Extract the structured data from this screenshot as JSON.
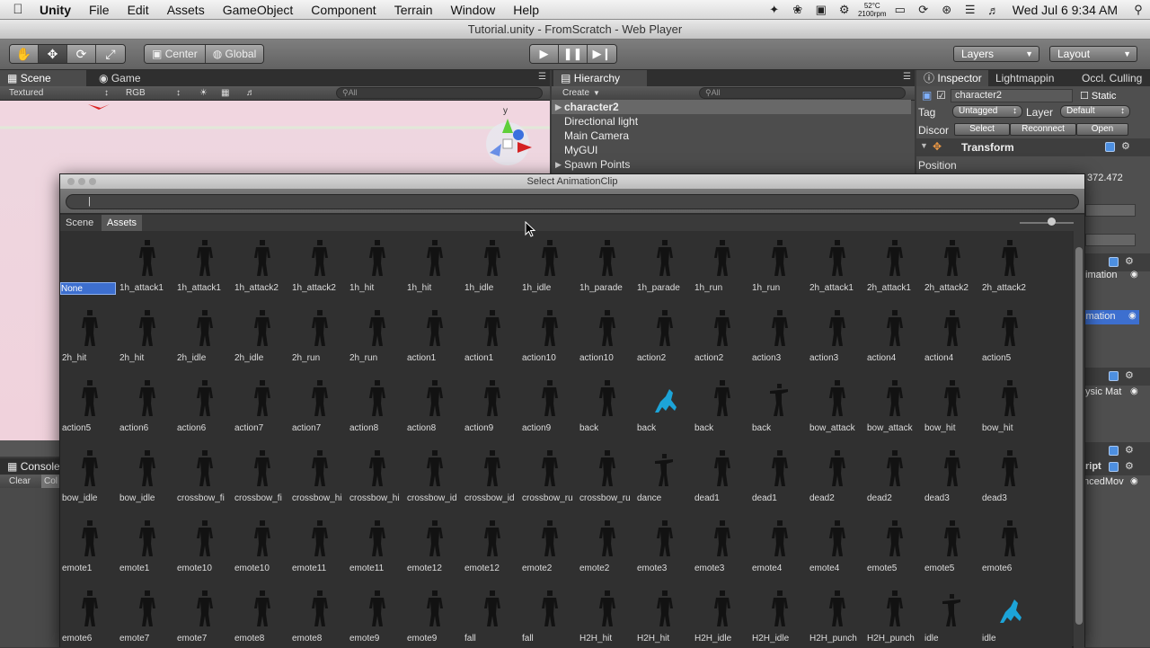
{
  "menubar": {
    "app_name": "Unity",
    "items": [
      "File",
      "Edit",
      "Assets",
      "GameObject",
      "Component",
      "Terrain",
      "Window",
      "Help"
    ],
    "temperature": "52°C",
    "rpm": "2100rpm",
    "clock": "Wed Jul 6  9:34 AM"
  },
  "window": {
    "title": "Tutorial.unity - FromScratch - Web Player"
  },
  "toolbar": {
    "pivot": "Center",
    "space": "Global",
    "layers": "Layers",
    "layout": "Layout"
  },
  "scene_panel": {
    "tabs": [
      "Scene",
      "Game"
    ],
    "render_mode": "Textured",
    "color_mode": "RGB",
    "search_placeholder": "All",
    "gizmo_axis": "y"
  },
  "hierarchy": {
    "tab": "Hierarchy",
    "create": "Create",
    "search_placeholder": "All",
    "items": [
      {
        "label": "character2",
        "selected": true,
        "expandable": true
      },
      {
        "label": "Directional light",
        "selected": false,
        "expandable": false
      },
      {
        "label": "Main Camera",
        "selected": false,
        "expandable": false
      },
      {
        "label": "MyGUI",
        "selected": false,
        "expandable": false
      },
      {
        "label": "Spawn Points",
        "selected": false,
        "expandable": true
      }
    ]
  },
  "inspector": {
    "tabs": [
      "Inspector",
      "Lightmappin",
      "Occl. Culling"
    ],
    "object_name": "character2",
    "static_label": "Static",
    "tag_label": "Tag",
    "tag_value": "Untagged",
    "layer_label": "Layer",
    "layer_value": "Default",
    "prefab_label": "Discor",
    "prefab_buttons": [
      "Select",
      "Reconnect",
      "Open"
    ],
    "transform_title": "Transform",
    "position_label": "Position",
    "position_value_partial": "372.472",
    "animation_partial": "imation",
    "animation_selected_partial": "imation",
    "physic_partial": "ysic Mat",
    "script_partial": "ript",
    "script_name_partial": "ncedMov"
  },
  "console": {
    "tab": "Console",
    "clear": "Clear",
    "col": "Col"
  },
  "dialog": {
    "title": "Select AnimationClip",
    "search_value": "",
    "tabs": [
      "Scene",
      "Assets"
    ],
    "active_tab": "Assets",
    "items": [
      {
        "label": "None",
        "type": "none"
      },
      {
        "label": "1h_attack1",
        "type": "dark"
      },
      {
        "label": "1h_attack1",
        "type": "dark"
      },
      {
        "label": "1h_attack2",
        "type": "dark"
      },
      {
        "label": "1h_attack2",
        "type": "dark"
      },
      {
        "label": "1h_hit",
        "type": "dark"
      },
      {
        "label": "1h_hit",
        "type": "dark"
      },
      {
        "label": "1h_idle",
        "type": "dark"
      },
      {
        "label": "1h_idle",
        "type": "dark"
      },
      {
        "label": "1h_parade",
        "type": "dark"
      },
      {
        "label": "1h_parade",
        "type": "dark"
      },
      {
        "label": "1h_run",
        "type": "dark"
      },
      {
        "label": "1h_run",
        "type": "dark"
      },
      {
        "label": "2h_attack1",
        "type": "dark"
      },
      {
        "label": "2h_attack1",
        "type": "dark"
      },
      {
        "label": "2h_attack2",
        "type": "dark"
      },
      {
        "label": "2h_attack2",
        "type": "dark"
      },
      {
        "label": "2h_hit",
        "type": "dark"
      },
      {
        "label": "2h_hit",
        "type": "dark"
      },
      {
        "label": "2h_idle",
        "type": "dark"
      },
      {
        "label": "2h_idle",
        "type": "dark"
      },
      {
        "label": "2h_run",
        "type": "dark"
      },
      {
        "label": "2h_run",
        "type": "dark"
      },
      {
        "label": "action1",
        "type": "dark"
      },
      {
        "label": "action1",
        "type": "dark"
      },
      {
        "label": "action10",
        "type": "dark"
      },
      {
        "label": "action10",
        "type": "dark"
      },
      {
        "label": "action2",
        "type": "dark"
      },
      {
        "label": "action2",
        "type": "dark"
      },
      {
        "label": "action3",
        "type": "dark"
      },
      {
        "label": "action3",
        "type": "dark"
      },
      {
        "label": "action4",
        "type": "dark"
      },
      {
        "label": "action4",
        "type": "dark"
      },
      {
        "label": "action5",
        "type": "dark"
      },
      {
        "label": "action5",
        "type": "dark"
      },
      {
        "label": "action6",
        "type": "dark"
      },
      {
        "label": "action6",
        "type": "dark"
      },
      {
        "label": "action7",
        "type": "dark"
      },
      {
        "label": "action7",
        "type": "dark"
      },
      {
        "label": "action8",
        "type": "dark"
      },
      {
        "label": "action8",
        "type": "dark"
      },
      {
        "label": "action9",
        "type": "dark"
      },
      {
        "label": "action9",
        "type": "dark"
      },
      {
        "label": "back",
        "type": "dark"
      },
      {
        "label": "back",
        "type": "blue"
      },
      {
        "label": "back",
        "type": "dark"
      },
      {
        "label": "back",
        "type": "pose"
      },
      {
        "label": "bow_attack",
        "type": "dark"
      },
      {
        "label": "bow_attack",
        "type": "dark"
      },
      {
        "label": "bow_hit",
        "type": "dark"
      },
      {
        "label": "bow_hit",
        "type": "dark"
      },
      {
        "label": "bow_idle",
        "type": "dark"
      },
      {
        "label": "bow_idle",
        "type": "dark"
      },
      {
        "label": "crossbow_fi",
        "type": "dark"
      },
      {
        "label": "crossbow_fi",
        "type": "dark"
      },
      {
        "label": "crossbow_hi",
        "type": "dark"
      },
      {
        "label": "crossbow_hi",
        "type": "dark"
      },
      {
        "label": "crossbow_id",
        "type": "dark"
      },
      {
        "label": "crossbow_id",
        "type": "dark"
      },
      {
        "label": "crossbow_ru",
        "type": "dark"
      },
      {
        "label": "crossbow_ru",
        "type": "dark"
      },
      {
        "label": "dance",
        "type": "pose"
      },
      {
        "label": "dead1",
        "type": "dark"
      },
      {
        "label": "dead1",
        "type": "dark"
      },
      {
        "label": "dead2",
        "type": "dark"
      },
      {
        "label": "dead2",
        "type": "dark"
      },
      {
        "label": "dead3",
        "type": "dark"
      },
      {
        "label": "dead3",
        "type": "dark"
      },
      {
        "label": "emote1",
        "type": "dark"
      },
      {
        "label": "emote1",
        "type": "dark"
      },
      {
        "label": "emote10",
        "type": "dark"
      },
      {
        "label": "emote10",
        "type": "dark"
      },
      {
        "label": "emote11",
        "type": "dark"
      },
      {
        "label": "emote11",
        "type": "dark"
      },
      {
        "label": "emote12",
        "type": "dark"
      },
      {
        "label": "emote12",
        "type": "dark"
      },
      {
        "label": "emote2",
        "type": "dark"
      },
      {
        "label": "emote2",
        "type": "dark"
      },
      {
        "label": "emote3",
        "type": "dark"
      },
      {
        "label": "emote3",
        "type": "dark"
      },
      {
        "label": "emote4",
        "type": "dark"
      },
      {
        "label": "emote4",
        "type": "dark"
      },
      {
        "label": "emote5",
        "type": "dark"
      },
      {
        "label": "emote5",
        "type": "dark"
      },
      {
        "label": "emote6",
        "type": "dark"
      },
      {
        "label": "emote6",
        "type": "dark"
      },
      {
        "label": "emote7",
        "type": "dark"
      },
      {
        "label": "emote7",
        "type": "dark"
      },
      {
        "label": "emote8",
        "type": "dark"
      },
      {
        "label": "emote8",
        "type": "dark"
      },
      {
        "label": "emote9",
        "type": "dark"
      },
      {
        "label": "emote9",
        "type": "dark"
      },
      {
        "label": "fall",
        "type": "dark"
      },
      {
        "label": "fall",
        "type": "dark"
      },
      {
        "label": "H2H_hit",
        "type": "dark"
      },
      {
        "label": "H2H_hit",
        "type": "dark"
      },
      {
        "label": "H2H_idle",
        "type": "dark"
      },
      {
        "label": "H2H_idle",
        "type": "dark"
      },
      {
        "label": "H2H_punch",
        "type": "dark"
      },
      {
        "label": "H2H_punch",
        "type": "dark"
      },
      {
        "label": "idle",
        "type": "pose"
      },
      {
        "label": "idle",
        "type": "blue"
      }
    ]
  }
}
